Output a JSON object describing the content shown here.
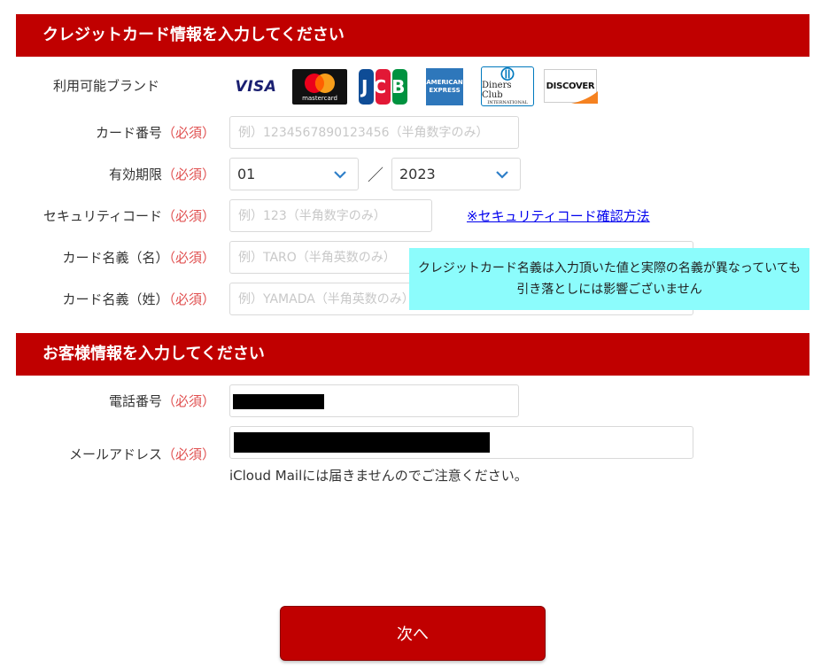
{
  "card_section": {
    "title": "クレジットカード情報を入力してください",
    "brand_label": "利用可能ブランド",
    "brands": {
      "visa": "VISA",
      "mastercard": "mastercard",
      "jcb": "JCB",
      "amex_line1": "AMERICAN",
      "amex_line2": "EXPRESS",
      "diners_line1": "Diners Club",
      "diners_line2": "INTERNATIONAL",
      "discover": "DISCOVER"
    },
    "required_mark": "（必須）",
    "card_number": {
      "label": "カード番号",
      "placeholder": "例）1234567890123456（半角数字のみ）"
    },
    "expiry": {
      "label": "有効期限",
      "month": "01",
      "separator": "／",
      "year": "2023"
    },
    "security_code": {
      "label": "セキュリティコード",
      "placeholder": "例）123（半角数字のみ）",
      "help_link": "※セキュリティコード確認方法"
    },
    "name_first": {
      "label": "カード名義（名）",
      "placeholder": "例）TARO（半角英数のみ）"
    },
    "name_last": {
      "label": "カード名義（姓）",
      "placeholder": "例）YAMADA（半角英数のみ）"
    },
    "tooltip_line1": "クレジットカード名義は入力頂いた値と実際の名義が異なっていても",
    "tooltip_line2": "引き落としには影響ございません"
  },
  "customer_section": {
    "title": "お客様情報を入力してください",
    "phone": {
      "label": "電話番号"
    },
    "email": {
      "label": "メールアドレス",
      "note": "iCloud Mailには届きませんのでご注意ください。"
    }
  },
  "next_button": "次へ",
  "colors": {
    "header_red": "#c00000",
    "required_red": "#e05050",
    "tooltip_cyan": "#8cfcfc",
    "link_blue": "#0000ee",
    "chevron_blue": "#2f7fc8"
  }
}
